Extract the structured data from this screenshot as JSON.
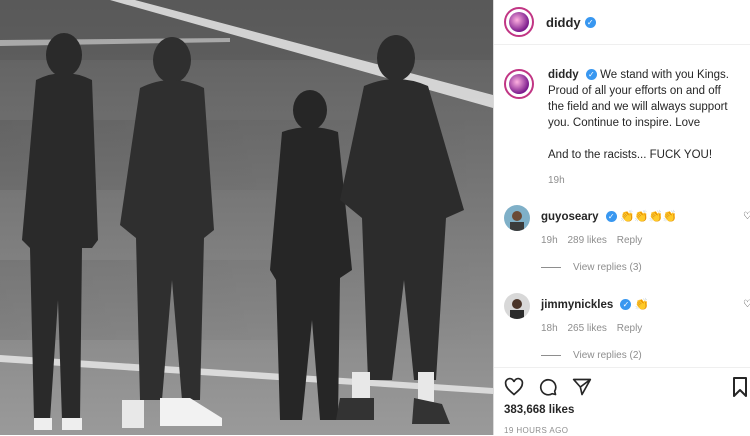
{
  "header": {
    "username": "diddy"
  },
  "caption": {
    "username": "diddy",
    "text_line1": "We stand with you Kings. Proud of all your efforts on and off the field and we will always support you. Continue to inspire. Love",
    "text_line2": "And to the racists... FUCK YOU!",
    "time": "19h"
  },
  "comments": [
    {
      "username": "guyoseary",
      "text": "👏👏👏👏",
      "time": "19h",
      "likes": "289 likes",
      "reply": "Reply",
      "view_replies": "View replies (3)"
    },
    {
      "username": "jimmynickles",
      "text": "👏",
      "time": "18h",
      "likes": "265 likes",
      "reply": "Reply",
      "view_replies": "View replies (2)"
    }
  ],
  "footer": {
    "likes": "383,668 likes",
    "posted_ago": "19 HOURS AGO"
  },
  "icons": [
    "heart-icon",
    "comment-icon",
    "share-icon",
    "bookmark-icon",
    "verified-badge-icon"
  ],
  "colors": {
    "verified": "#3897f0",
    "avatar_ring": "#c13584",
    "muted": "#8e8e8e"
  }
}
